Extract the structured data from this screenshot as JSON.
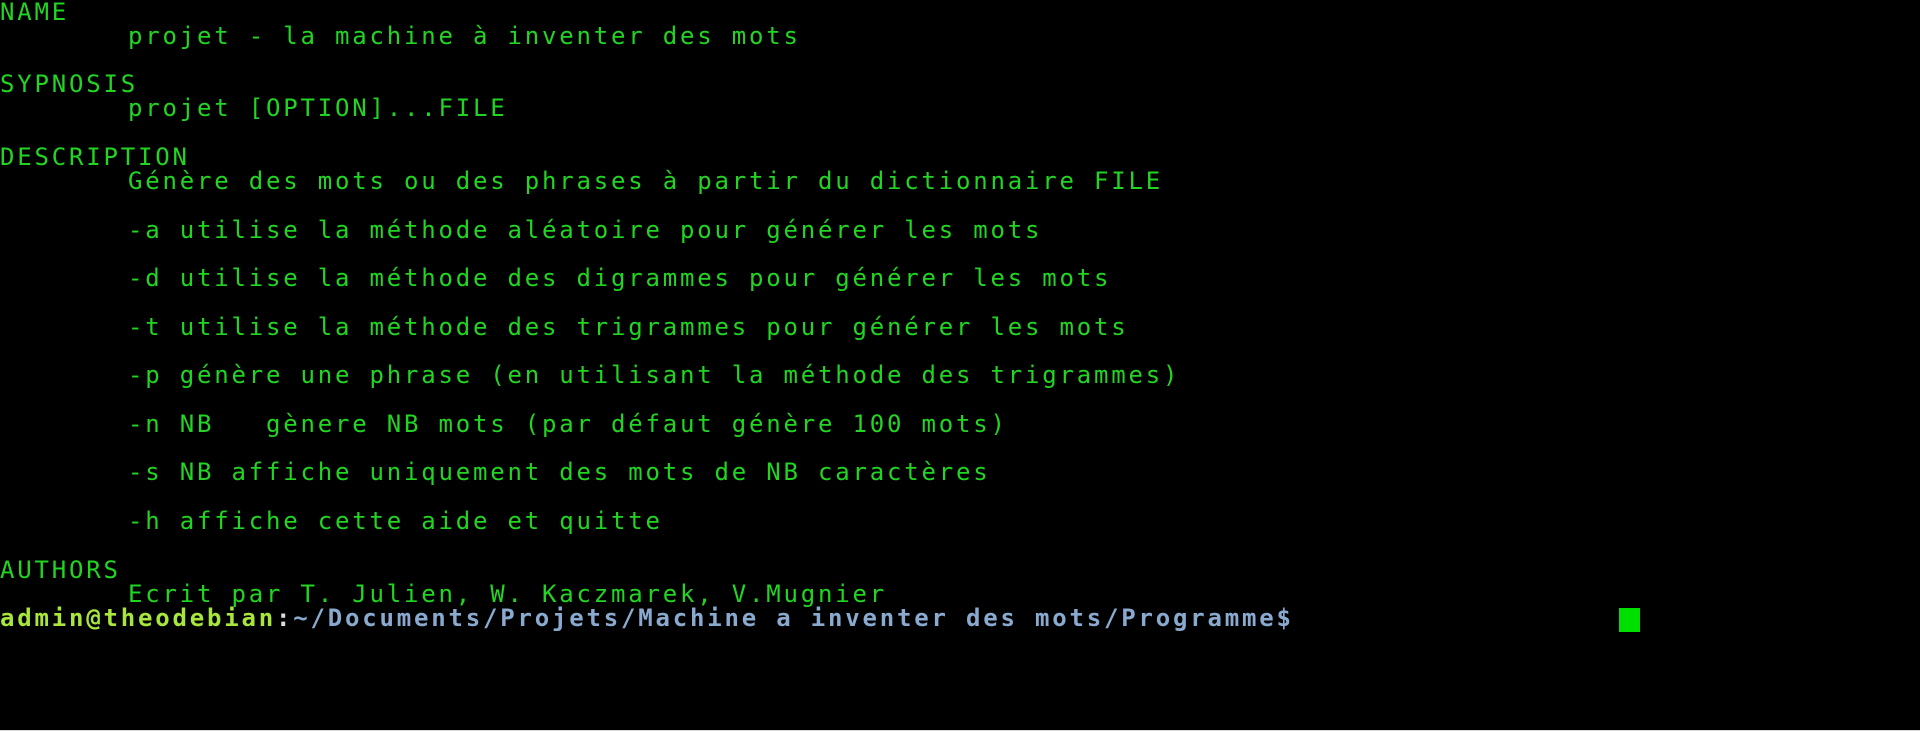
{
  "terminal": {
    "text_color": "#22d522",
    "background": "#000000",
    "man_page": {
      "name_heading": "NAME",
      "name_text": "projet - la machine à inventer des mots",
      "synopsis_heading": "SYPNOSIS",
      "synopsis_text": "projet [OPTION]...FILE",
      "description_heading": "DESCRIPTION",
      "description_text": "Génère des mots ou des phrases à partir du dictionnaire FILE",
      "options": [
        "-a utilise la méthode aléatoire pour générer les mots",
        "-d utilise la méthode des digrammes pour générer les mots",
        "-t utilise la méthode des trigrammes pour générer les mots",
        "-p génère une phrase (en utilisant la méthode des trigrammes)",
        "-n NB   gènere NB mots (par défaut génère 100 mots)",
        "-s NB affiche uniquement des mots de NB caractères",
        "-h affiche cette aide et quitte"
      ],
      "authors_heading": "AUTHORS",
      "authors_text": "Ecrit par T. Julien, W. Kaczmarek, V.Mugnier"
    },
    "prompt": {
      "user_host": "admin@theodebian",
      "separator": ":",
      "path": "~/Documents/Projets/Machine a inventer des mots/Programme$",
      "user_color": "#a8e63c",
      "path_color": "#8aa9cf",
      "cursor_color": "#00e000"
    }
  }
}
